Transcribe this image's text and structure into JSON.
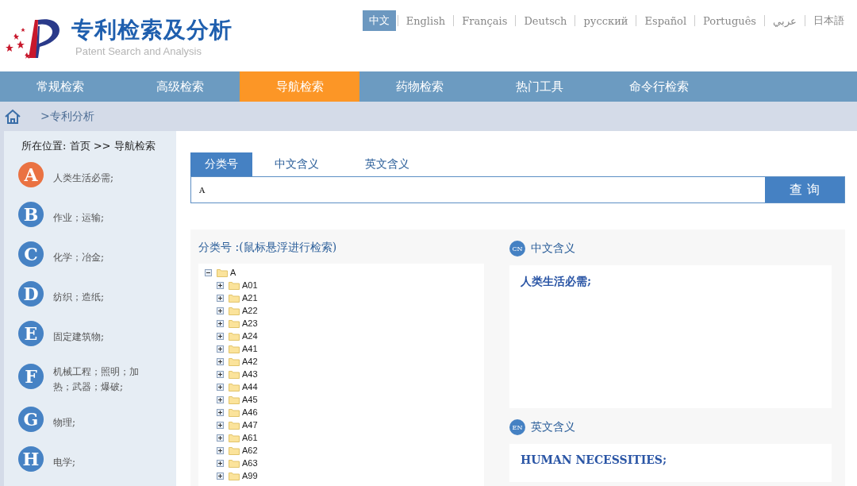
{
  "header": {
    "title": "专利检索及分析",
    "subtitle": "Patent Search and Analysis"
  },
  "languages": [
    {
      "label": "中文",
      "selected": true
    },
    {
      "label": "English",
      "selected": false
    },
    {
      "label": "Français",
      "selected": false
    },
    {
      "label": "Deutsch",
      "selected": false
    },
    {
      "label": "русский",
      "selected": false
    },
    {
      "label": "Español",
      "selected": false
    },
    {
      "label": "Português",
      "selected": false
    },
    {
      "label": "عربي",
      "selected": false
    },
    {
      "label": "日本語",
      "selected": false
    }
  ],
  "nav": [
    {
      "label": "常规检索",
      "selected": false
    },
    {
      "label": "高级检索",
      "selected": false
    },
    {
      "label": "导航检索",
      "selected": true
    },
    {
      "label": "药物检索",
      "selected": false
    },
    {
      "label": "热门工具",
      "selected": false
    },
    {
      "label": "命令行检索",
      "selected": false
    }
  ],
  "breadcrumb": ">专利分析",
  "location": "所在位置: 首页 >> 导航检索",
  "sections": [
    {
      "letter": "A",
      "label": "人类生活必需;",
      "selected": true
    },
    {
      "letter": "B",
      "label": "作业；运输;",
      "selected": false
    },
    {
      "letter": "C",
      "label": "化学；冶金;",
      "selected": false
    },
    {
      "letter": "D",
      "label": "纺织；造纸;",
      "selected": false
    },
    {
      "letter": "E",
      "label": "固定建筑物;",
      "selected": false
    },
    {
      "letter": "F",
      "label": "机械工程；照明；加热；武器；爆破;",
      "selected": false
    },
    {
      "letter": "G",
      "label": "物理;",
      "selected": false
    },
    {
      "letter": "H",
      "label": "电学;",
      "selected": false
    }
  ],
  "search_tabs": [
    {
      "label": "分类号",
      "selected": true
    },
    {
      "label": "中文含义",
      "selected": false
    },
    {
      "label": "英文含义",
      "selected": false
    }
  ],
  "search": {
    "value": "A",
    "button": "查 询"
  },
  "tree_title": "分类号 :(鼠标悬浮进行检索)",
  "tree": [
    {
      "label": "A",
      "expanded": true,
      "children": [
        {
          "label": "A01",
          "expanded": false
        },
        {
          "label": "A21",
          "expanded": false
        },
        {
          "label": "A22",
          "expanded": false
        },
        {
          "label": "A23",
          "expanded": false
        },
        {
          "label": "A24",
          "expanded": false
        },
        {
          "label": "A41",
          "expanded": false
        },
        {
          "label": "A42",
          "expanded": false
        },
        {
          "label": "A43",
          "expanded": false
        },
        {
          "label": "A44",
          "expanded": false
        },
        {
          "label": "A45",
          "expanded": false
        },
        {
          "label": "A46",
          "expanded": false
        },
        {
          "label": "A47",
          "expanded": false
        },
        {
          "label": "A61",
          "expanded": false
        },
        {
          "label": "A62",
          "expanded": false
        },
        {
          "label": "A63",
          "expanded": false
        },
        {
          "label": "A99",
          "expanded": false
        }
      ]
    }
  ],
  "meanings": [
    {
      "badge": "CN",
      "title": "中文含义",
      "text": "人类生活必需;"
    },
    {
      "badge": "EN",
      "title": "英文含义",
      "text": "HUMAN NECESSITIES;"
    }
  ]
}
